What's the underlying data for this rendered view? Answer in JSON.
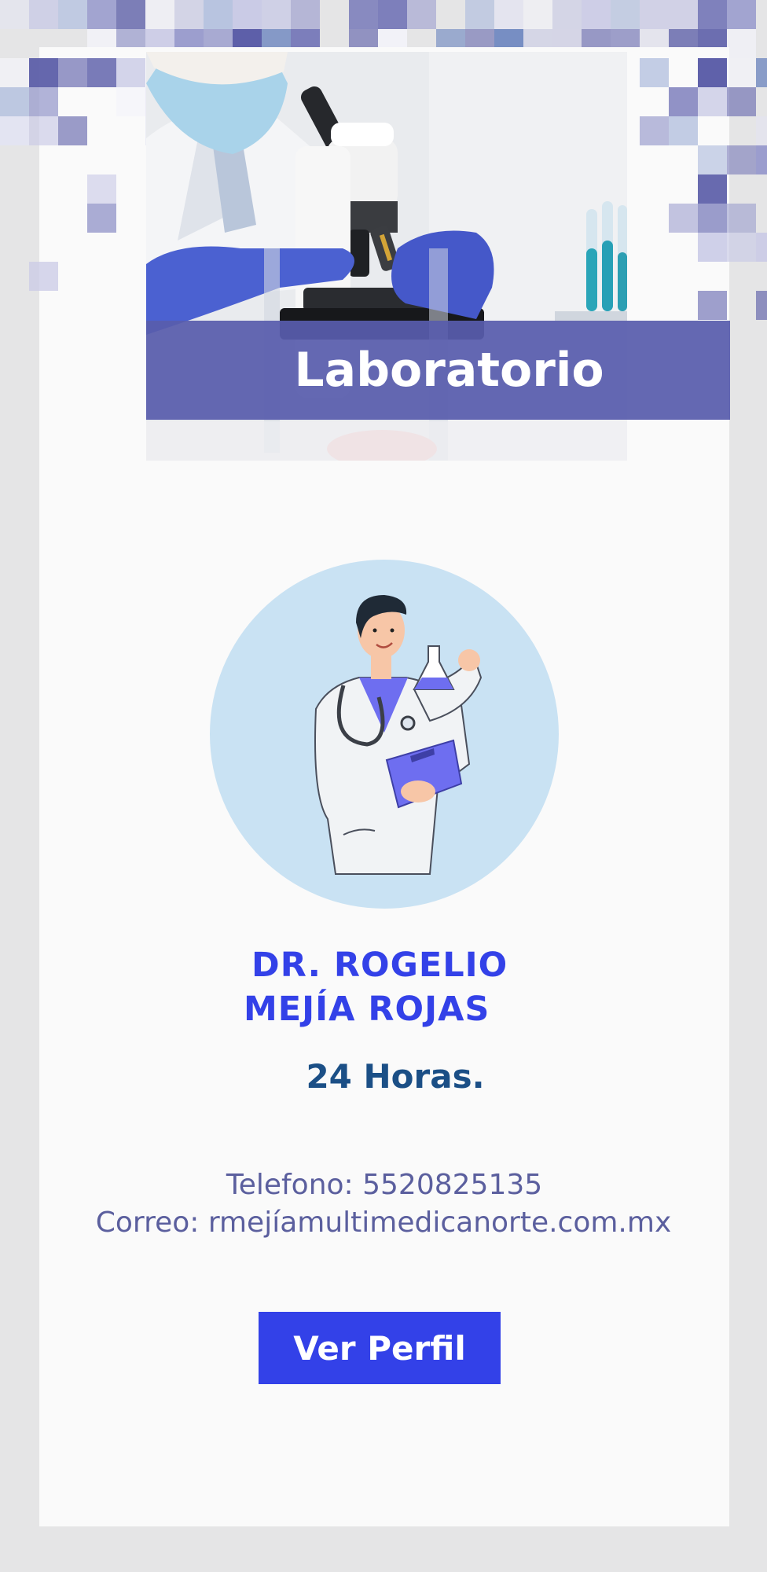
{
  "header": {
    "banner_title": "Laboratorio"
  },
  "doctor": {
    "name_line1": "DR. ROGELIO",
    "name_line2": "MEJÍA ROJAS",
    "hours": "24 Horas."
  },
  "contact": {
    "phone": "Telefono: 5520825135",
    "email": "Correo: rmejíamultimedicanorte.com.mx"
  },
  "actions": {
    "profile_label": "Ver Perfil"
  },
  "colors": {
    "accent": "#3341e8",
    "banner": "#585cac",
    "hours_text": "#1b4f86",
    "contact_text": "#5b5f9e",
    "avatar_bg": "#c9e2f3",
    "page_bg": "#e5e5e6",
    "card_bg": "#fafafa"
  },
  "icons": {
    "hero": "laboratory-microscope-photo",
    "avatar": "doctor-with-flask-illustration"
  }
}
